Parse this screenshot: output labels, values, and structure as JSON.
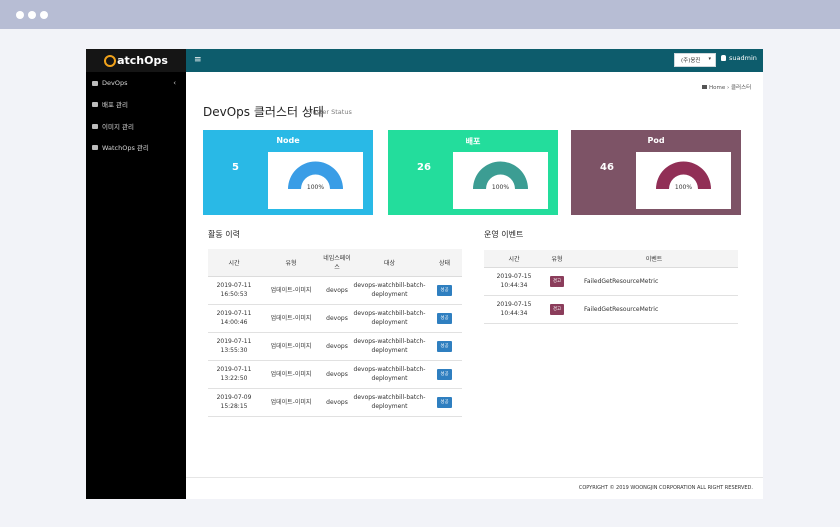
{
  "app": {
    "logo_text": "atchOps"
  },
  "sidebar": {
    "items": [
      {
        "label": "DevOps",
        "icon": "cloud-icon",
        "caret": "‹"
      },
      {
        "label": "배포 관리",
        "icon": "grid-icon"
      },
      {
        "label": "이미지 관리",
        "icon": "image-icon"
      },
      {
        "label": "WatchOps 관리",
        "icon": "users-icon"
      }
    ]
  },
  "topbar": {
    "menu_icon": "≡",
    "select_value": "(주)웅진",
    "select_arrow": "▾",
    "user": "suadmin"
  },
  "breadcrumb": {
    "home": "Home",
    "sep": "›",
    "current": "클러스터"
  },
  "page": {
    "title": "DevOps 클러스터 상태",
    "subtitle": "Cluster Status"
  },
  "cards": [
    {
      "title": "Node",
      "count": "5",
      "percent": "100%",
      "percent_value": 100,
      "bg": "#29b9e6",
      "gauge": "#3a9de6"
    },
    {
      "title": "배포",
      "count": "26",
      "percent": "100%",
      "percent_value": 100,
      "bg": "#23dd9c",
      "gauge": "#3c9d93"
    },
    {
      "title": "Pod",
      "count": "46",
      "percent": "100%",
      "percent_value": 100,
      "bg": "#7d5366",
      "gauge": "#912f56"
    }
  ],
  "activity": {
    "title": "활동 이력",
    "headers": [
      "시간",
      "유형",
      "네임스페이스",
      "대상",
      "상태"
    ],
    "rows": [
      {
        "time": "2019-07-11 16:50:53",
        "type": "업데이트-이미지",
        "ns": "devops",
        "target": "devops-watchbill-batch-deployment",
        "status": "성공"
      },
      {
        "time": "2019-07-11 14:00:46",
        "type": "업데이트-이미지",
        "ns": "devops",
        "target": "devops-watchbill-batch-deployment",
        "status": "성공"
      },
      {
        "time": "2019-07-11 13:55:30",
        "type": "업데이트-이미지",
        "ns": "devops",
        "target": "devops-watchbill-batch-deployment",
        "status": "성공"
      },
      {
        "time": "2019-07-11 13:22:50",
        "type": "업데이트-이미지",
        "ns": "devops",
        "target": "devops-watchbill-batch-deployment",
        "status": "성공"
      },
      {
        "time": "2019-07-09 15:28:15",
        "type": "업데이트-이미지",
        "ns": "devops",
        "target": "devops-watchbill-batch-deployment",
        "status": "성공"
      }
    ]
  },
  "events": {
    "title": "운영 이벤트",
    "headers": [
      "시간",
      "유형",
      "이벤트"
    ],
    "rows": [
      {
        "time": "2019-07-15 10:44:34",
        "type": "경고",
        "event": "FailedGetResourceMetric"
      },
      {
        "time": "2019-07-15 10:44:34",
        "type": "경고",
        "event": "FailedGetResourceMetric"
      }
    ]
  },
  "footer": {
    "text": "COPYRIGHT © 2019 WOONGJIN CORPORATION ALL RIGHT RESERVED."
  }
}
